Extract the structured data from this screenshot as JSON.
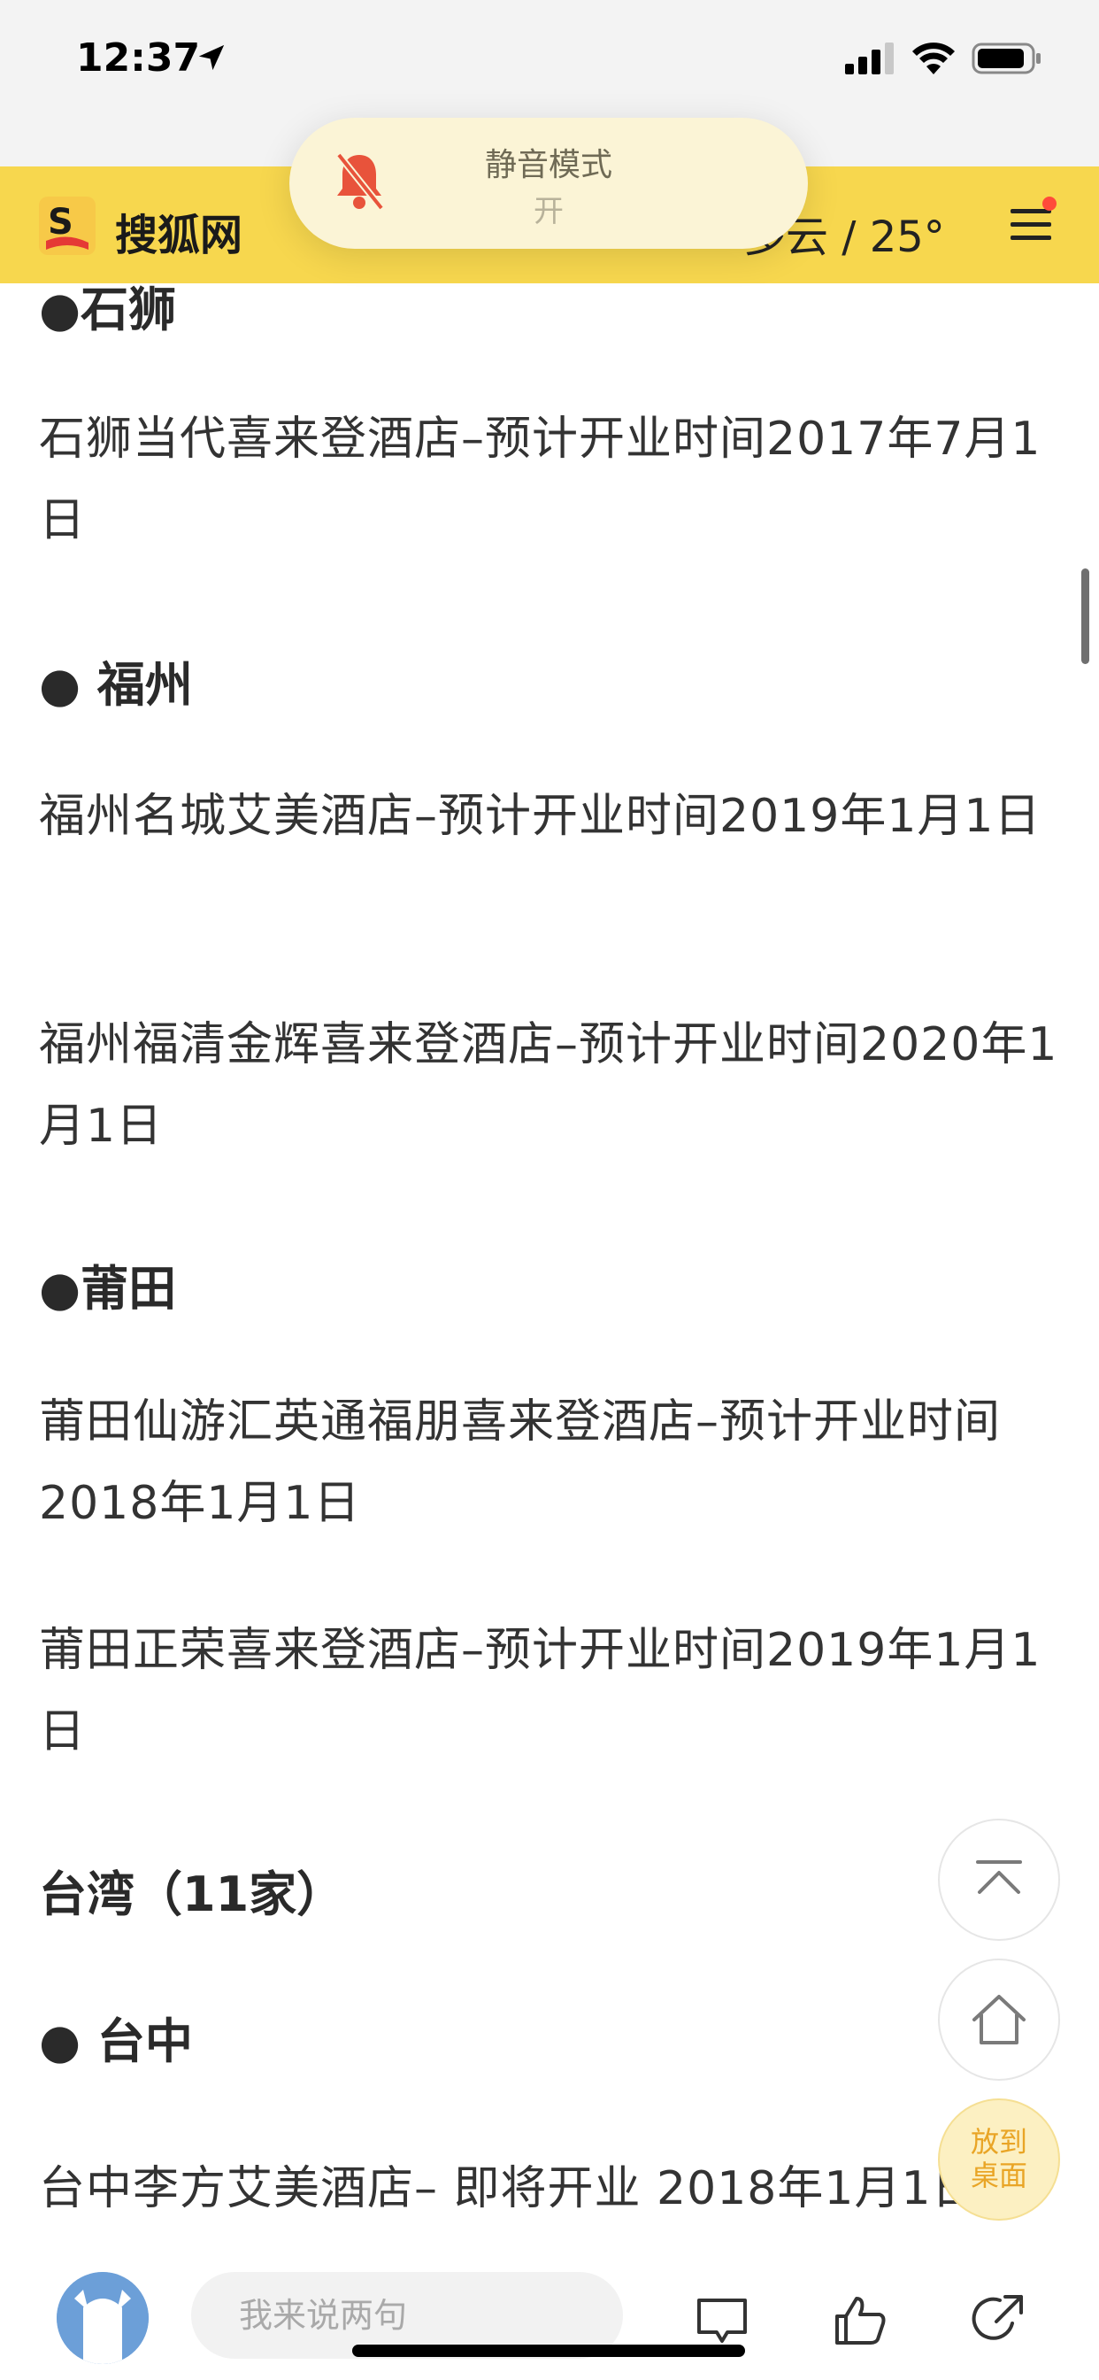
{
  "status_bar": {
    "time": "12:37",
    "icons": [
      "location-arrow-icon",
      "signal-icon",
      "wifi-icon",
      "battery-icon"
    ]
  },
  "header": {
    "brand": "搜狐网",
    "weather": "多云 / 25°",
    "logo_icon": "sohu-logo-icon",
    "menu_icon": "hamburger-menu-icon",
    "accent_color": "#f7d74e"
  },
  "toast": {
    "title": "静音模式",
    "status": "开",
    "icon": "bell-slash-icon"
  },
  "article": {
    "blocks": [
      {
        "type": "heading",
        "text": "●石狮"
      },
      {
        "type": "para",
        "text": "石狮当代喜来登酒店–预计开业时间2017年7月1日"
      },
      {
        "type": "heading",
        "text": "● 福州"
      },
      {
        "type": "para",
        "text": "福州名城艾美酒店–预计开业时间2019年1月1日"
      },
      {
        "type": "para",
        "text": "福州福清金辉喜来登酒店–预计开业时间2020年1月1日"
      },
      {
        "type": "heading",
        "text": "●莆田"
      },
      {
        "type": "para",
        "text": "莆田仙游汇英通福朋喜来登酒店–预计开业时间2018年1月1日"
      },
      {
        "type": "para",
        "text": "莆田正荣喜来登酒店–预计开业时间2019年1月1日"
      },
      {
        "type": "heading",
        "text": "台湾（11家）"
      },
      {
        "type": "heading",
        "text": "● 台中"
      },
      {
        "type": "para",
        "text": "台中李方艾美酒店– 即将开业 2018年1月1日"
      }
    ]
  },
  "floating": {
    "back_to_top_icon": "arrow-up-to-top-icon",
    "home_icon": "home-icon",
    "desktop_line1": "放到",
    "desktop_line2": "桌面"
  },
  "bottom_bar": {
    "comment_placeholder": "我来说两句",
    "icons": [
      "user-avatar",
      "comment-icon",
      "thumbs-up-icon",
      "share-icon"
    ]
  }
}
